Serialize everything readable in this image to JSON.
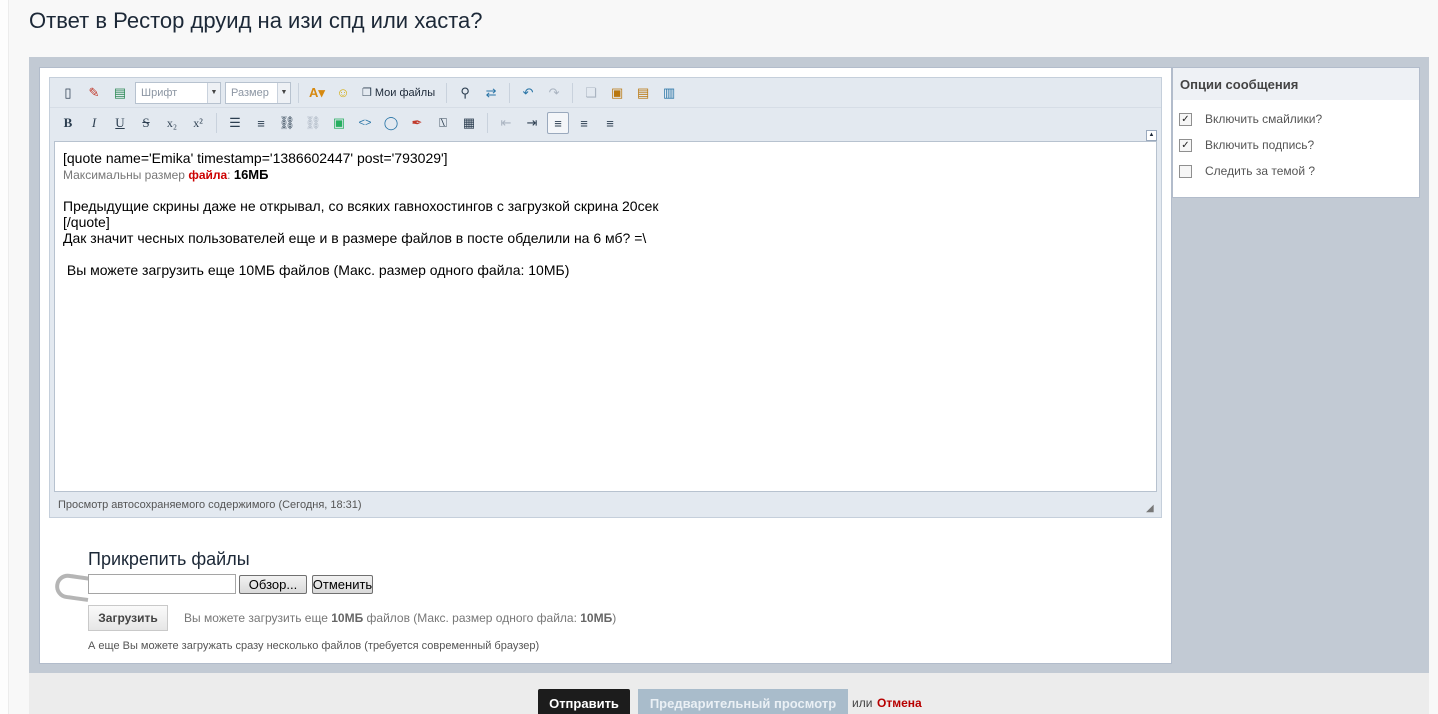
{
  "title": "Ответ в Рестор друид на изи спд или хаста?",
  "toolbar": {
    "font_label": "Шрифт",
    "size_label": "Размер",
    "my_files_label": "Мои файлы"
  },
  "editor": {
    "lines": [
      "[quote name='Emika' timestamp='1386602447' post='793029']",
      "",
      "",
      "Предыдущие скрины даже не открывал, со всяких гавнохостингов с загрузкой скрина 20сек",
      "[/quote]",
      "Дак значит чесных пользователей еще и в размере файлов в посте обделили на 6 мб? =\\",
      "",
      " Вы можете загрузить еще 10МБ файлов (Макс. размер одного файла: 10МБ)"
    ],
    "maxsize_prefix": "Максимальны размер ",
    "maxsize_word": "файла",
    "maxsize_colon": ": ",
    "maxsize_value": "16МБ",
    "autosave": "Просмотр автосохраняемого содержимого (Сегодня, 18:31)"
  },
  "attach": {
    "title": "Прикрепить файлы",
    "browse": "Обзор...",
    "cancel": "Отменить",
    "upload": "Загрузить",
    "note_prefix": "Вы можете загрузить еще ",
    "note_amount": "10МБ",
    "note_mid": " файлов (Макс. размер одного файла: ",
    "note_max": "10МБ",
    "note_suffix": ")",
    "multi": "А еще Вы можете загружать сразу несколько файлов (требуется современный браузер)"
  },
  "options": {
    "title": "Опции сообщения",
    "items": [
      {
        "label": "Включить смайлики?",
        "checked": true
      },
      {
        "label": "Включить подпись?",
        "checked": true
      },
      {
        "label": "Следить за темой ?",
        "checked": false
      }
    ]
  },
  "footer": {
    "submit": "Отправить",
    "preview": "Предварительный просмотр",
    "or": "или",
    "cancel": "Отмена"
  }
}
